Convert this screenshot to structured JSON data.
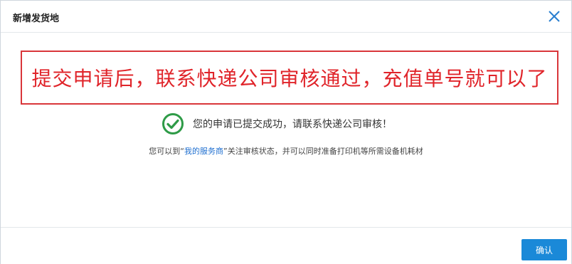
{
  "dialog": {
    "title": "新增发货地",
    "close_icon": "close-icon"
  },
  "banner": {
    "text": "提交申请后，联系快递公司审核通过，充值单号就可以了"
  },
  "success": {
    "icon": "check-circle-icon",
    "message": "您的申请已提交成功，请联系快递公司审核！"
  },
  "info": {
    "prefix": "您可以到“",
    "link_text": "我的服务商",
    "suffix": "”关注审核状态，并可以同时准备打印机等所需设备机耗材"
  },
  "footer": {
    "confirm_label": "确认"
  },
  "colors": {
    "accent": "#1a89d8",
    "banner_red": "#e0242a",
    "success_green": "#2e9b47",
    "link_blue": "#1f6fd0"
  }
}
